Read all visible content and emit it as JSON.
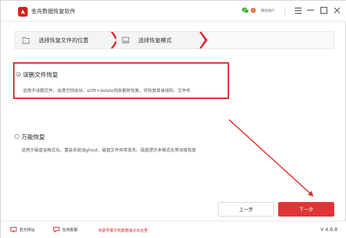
{
  "app": {
    "title": "金舟数据恢复软件",
    "user_label": "微信用户"
  },
  "steps": [
    {
      "label": "选择恢复文件的位置"
    },
    {
      "label": "选择恢复模式"
    }
  ],
  "options": [
    {
      "title": "误删文件恢复",
      "selected": true,
      "desc": "适用于误删文件、误清空回收站、shfit+delete彻底删除恢复，可恢复目录结构、文件名"
    },
    {
      "title": "万能恢复",
      "selected": false,
      "desc": "适用于磁盘误格式化、重装系统误ghost、磁盘文件异常丢失、磁盘提示未格式化等深度恢复"
    }
  ],
  "buttons": {
    "prev": "上一步",
    "next": "下一步"
  },
  "footer": {
    "website": "官方网站",
    "support": "在线客服",
    "mobile_link": "恢复苹果手机数据请点击这里",
    "version": "V 4.6.8"
  },
  "colors": {
    "accent": "#e03436",
    "highlight_border": "#d9282f",
    "annotation_arrow": "#e0342f"
  }
}
